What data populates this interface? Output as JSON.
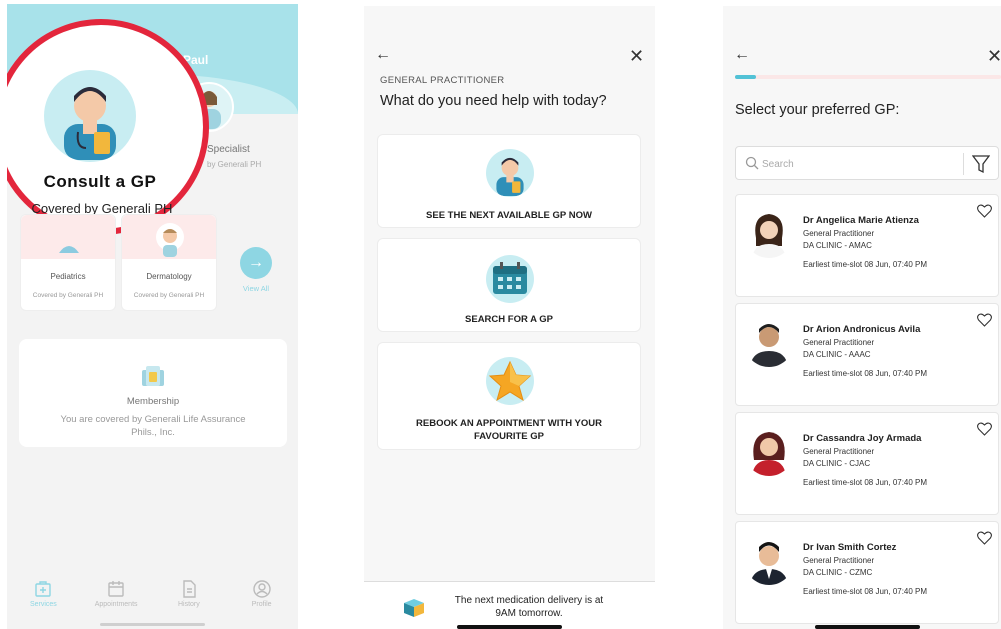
{
  "services_screen": {
    "user_name": "Paul",
    "highlight": {
      "title": "Consult a GP",
      "subtitle": "Covered by Generali PH"
    },
    "specialist": {
      "title": "Specialist",
      "subtitle": "by Generali PH"
    },
    "cards": [
      {
        "label": "Pediatrics",
        "sub": "Covered by Generali PH"
      },
      {
        "label": "Dermatology",
        "sub": "Covered by Generali PH"
      }
    ],
    "view_all": "View All",
    "membership": {
      "title": "Membership",
      "description": "You are covered by Generali Life Assurance Phils., Inc."
    },
    "nav": [
      {
        "label": "Services",
        "icon": "services-icon",
        "active": true
      },
      {
        "label": "Appointments",
        "icon": "calendar-icon",
        "active": false
      },
      {
        "label": "History",
        "icon": "history-icon",
        "active": false
      },
      {
        "label": "Profile",
        "icon": "profile-icon",
        "active": false
      }
    ]
  },
  "help_screen": {
    "eyebrow": "GENERAL PRACTITIONER",
    "question": "What do you need help with today?",
    "options": [
      {
        "label": "SEE THE NEXT AVAILABLE GP NOW",
        "icon": "doctor-icon"
      },
      {
        "label": "SEARCH FOR A GP",
        "icon": "calendar-icon"
      },
      {
        "label": "REBOOK AN APPOINTMENT WITH YOUR FAVOURITE GP",
        "icon": "star-icon"
      }
    ],
    "banner": "The next medication delivery is at 9AM tomorrow."
  },
  "select_gp_screen": {
    "progress": 0.08,
    "heading": "Select your preferred GP:",
    "search_placeholder": "Search",
    "doctors": [
      {
        "name": "Dr Angelica Marie Atienza",
        "role": "General Practitioner",
        "clinic": "DA CLINIC - AMAC",
        "slot": "Earliest time-slot 08 Jun, 07:40 PM"
      },
      {
        "name": "Dr Arion Andronicus Avila",
        "role": "General Practitioner",
        "clinic": "DA CLINIC - AAAC",
        "slot": "Earliest time-slot 08 Jun, 07:40 PM"
      },
      {
        "name": "Dr Cassandra Joy Armada",
        "role": "General Practitioner",
        "clinic": "DA CLINIC - CJAC",
        "slot": "Earliest time-slot 08 Jun, 07:40 PM"
      },
      {
        "name": "Dr Ivan Smith Cortez",
        "role": "General Practitioner",
        "clinic": "DA CLINIC - CZMC",
        "slot": "Earliest time-slot 08 Jun, 07:40 PM"
      }
    ]
  },
  "colors": {
    "accent": "#52c2d6",
    "highlight_ring": "#e3263c",
    "banner": "#a8e2ea"
  }
}
